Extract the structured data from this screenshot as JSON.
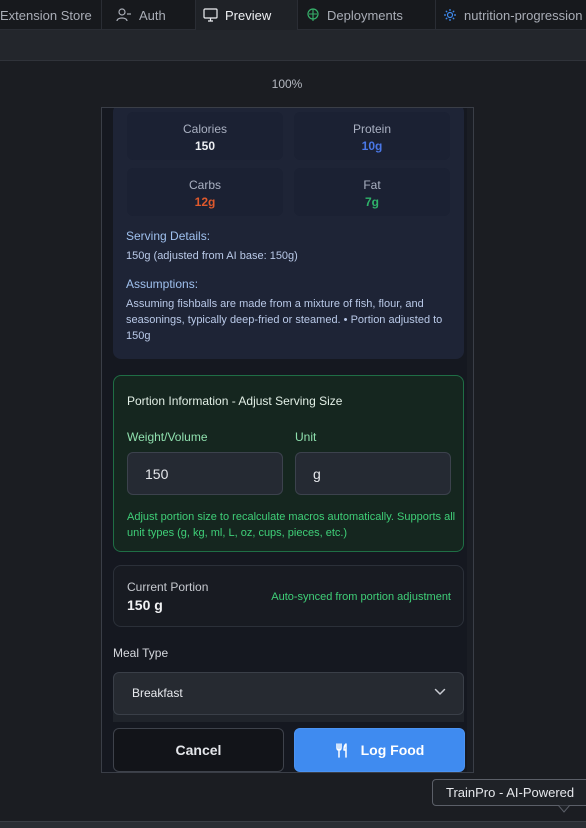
{
  "tabs": [
    {
      "label": "Extension Store",
      "icon": "extension-icon"
    },
    {
      "label": "Auth",
      "icon": "user-icon"
    },
    {
      "label": "Preview",
      "icon": "monitor-icon",
      "active": true
    },
    {
      "label": "Deployments",
      "icon": "globe-icon"
    },
    {
      "label": "nutrition-progression",
      "icon": "gear-icon"
    }
  ],
  "zoom": "100%",
  "analysis": {
    "macros": [
      {
        "label": "Calories",
        "value": "150"
      },
      {
        "label": "Protein",
        "value": "10g"
      },
      {
        "label": "Carbs",
        "value": "12g"
      },
      {
        "label": "Fat",
        "value": "7g"
      }
    ],
    "serving_title": "Serving Details:",
    "serving_text": "150g (adjusted from AI base: 150g)",
    "assumptions_title": "Assumptions:",
    "assumptions_text": "Assuming fishballs are made from a mixture of fish, flour, and seasonings, typically deep-fried or steamed. • Portion adjusted to 150g"
  },
  "portion": {
    "title": "Portion Information - Adjust Serving Size",
    "weight_label": "Weight/Volume",
    "weight_value": "150",
    "unit_label": "Unit",
    "unit_value": "g",
    "hint": "Adjust portion size to recalculate macros automatically. Supports all unit types (g, kg, ml, L, oz, cups, pieces, etc.)"
  },
  "current": {
    "label": "Current Portion",
    "value": "150 g",
    "sync_text": "Auto-synced from portion adjustment"
  },
  "meal": {
    "label": "Meal Type",
    "selected": "Breakfast"
  },
  "buttons": {
    "cancel": "Cancel",
    "log": "Log Food"
  },
  "tooltip": "TrainPro - AI-Powered",
  "colors": {
    "protein": "#4a78e8",
    "carbs": "#e0592c",
    "fat": "#2fb36a",
    "accent": "#3f8bf0",
    "success": "#3fcf78"
  }
}
